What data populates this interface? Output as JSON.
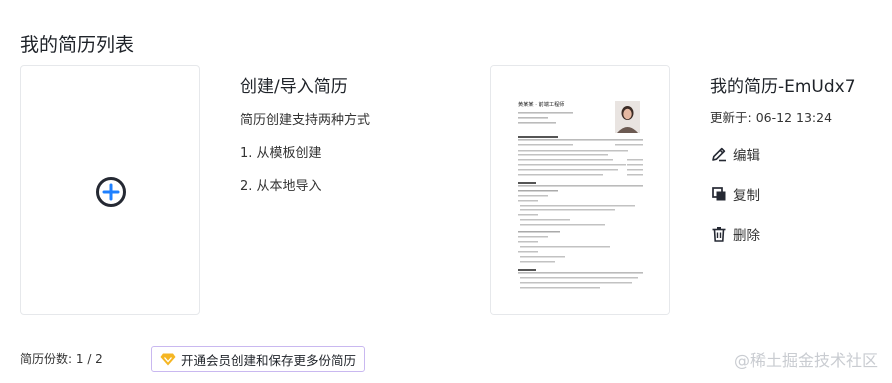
{
  "page": {
    "title": "我的简历列表"
  },
  "create": {
    "title": "创建/导入简历",
    "subtitle": "简历创建支持两种方式",
    "option1": "1. 从模板创建",
    "option2": "2. 从本地导入"
  },
  "resume": {
    "name": "我的简历-EmUdx7",
    "updated_label": "更新于:",
    "updated_time": "06-12 13:24",
    "thumb_heading": "黄某某 · 前端工程师",
    "actions": {
      "edit": "编辑",
      "copy": "复制",
      "delete": "删除"
    }
  },
  "footer": {
    "count_label": "简历份数:",
    "count_value": "1 / 2",
    "upgrade_label": "开通会员创建和保存更多份简历",
    "watermark": "@稀土掘金技术社区"
  },
  "colors": {
    "accent": "#1e80ff",
    "icon_dark": "#252933",
    "gem": "#f5b623",
    "upgrade_border": "#c9b8f0"
  },
  "icons": [
    "add-circle-icon",
    "edit-icon",
    "copy-icon",
    "delete-icon",
    "diamond-icon"
  ]
}
